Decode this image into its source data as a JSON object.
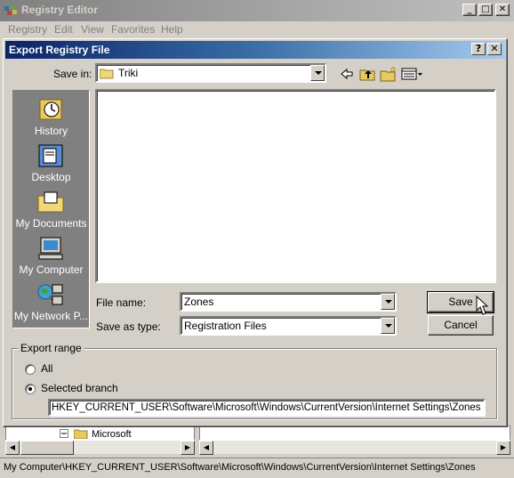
{
  "app": {
    "title": "Registry Editor",
    "menu": [
      "Registry",
      "Edit",
      "View",
      "Favorites",
      "Help"
    ],
    "window_buttons": {
      "minimize": "_",
      "maximize": "□",
      "close": "✕"
    }
  },
  "dialog": {
    "title": "Export Registry File",
    "help_button": "?",
    "close_button": "✕",
    "save_in_label": "Save in:",
    "save_in_value": "Triki",
    "places": [
      {
        "label": "History",
        "icon": "history-icon"
      },
      {
        "label": "Desktop",
        "icon": "desktop-icon"
      },
      {
        "label": "My Documents",
        "icon": "my-documents-icon"
      },
      {
        "label": "My Computer",
        "icon": "my-computer-icon"
      },
      {
        "label": "My Network P...",
        "icon": "my-network-places-icon"
      }
    ],
    "file_name_label": "File name:",
    "file_name_value": "Zones",
    "save_as_type_label": "Save as type:",
    "save_as_type_value": "Registration Files",
    "save_button": "Save",
    "cancel_button": "Cancel",
    "export_range": {
      "legend": "Export range",
      "all_label": "All",
      "selected_branch_label": "Selected branch",
      "selected_option": "selected_branch",
      "branch_path": "HKEY_CURRENT_USER\\Software\\Microsoft\\Windows\\CurrentVersion\\Internet Settings\\Zones"
    }
  },
  "tree": {
    "visible_item": "Microsoft"
  },
  "statusbar": {
    "text": "My Computer\\HKEY_CURRENT_USER\\Software\\Microsoft\\Windows\\CurrentVersion\\Internet Settings\\Zones"
  },
  "colors": {
    "dialog_title_start": "#0a246a",
    "dialog_title_end": "#a6caf0",
    "face": "#d4d0c8"
  }
}
